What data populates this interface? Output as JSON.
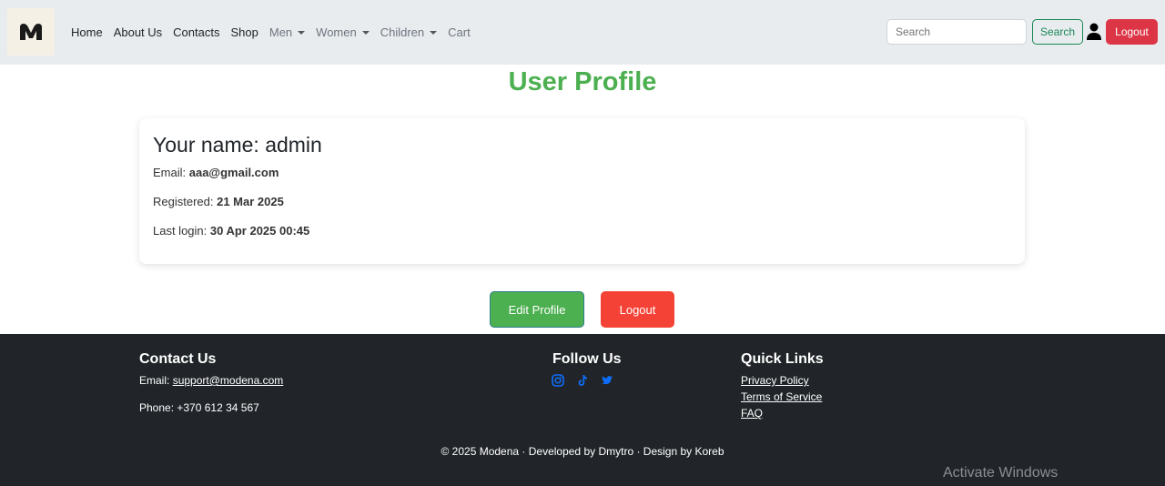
{
  "nav": {
    "logo": "Modena logo",
    "links": [
      {
        "label": "Home"
      },
      {
        "label": "About Us"
      },
      {
        "label": "Contacts"
      },
      {
        "label": "Shop"
      },
      {
        "label": "Men"
      },
      {
        "label": "Women"
      },
      {
        "label": "Children"
      },
      {
        "label": "Cart"
      }
    ],
    "search_placeholder": "Search",
    "search_button": "Search",
    "logout_button": "Logout"
  },
  "main": {
    "title": "User Profile",
    "name_label": "Your name: ",
    "name_value": "admin",
    "email_label": "Email: ",
    "email_value": "aaa@gmail.com",
    "registered_label": "Registered: ",
    "registered_value": "21 Mar 2025",
    "last_login_label": "Last login: ",
    "last_login_value": "30 Apr 2025 00:45",
    "edit_button": "Edit Profile",
    "logout_button": "Logout"
  },
  "footer": {
    "contact_heading": "Contact Us",
    "email_label": "Email: ",
    "email_value": "support@modena.com",
    "phone": "Phone: +370 612 34 567",
    "follow_heading": "Follow Us",
    "social_icons": [
      "instagram-icon",
      "tiktok-icon",
      "twitter-icon"
    ],
    "links_heading": "Quick Links",
    "links": [
      "Privacy Policy",
      "Terms of Service",
      "FAQ"
    ],
    "copyright": "© 2025 Modena · Developed by Dmytro · Design by Koreb"
  },
  "overlay": {
    "activate_windows": "Activate Windows"
  },
  "colors": {
    "accent_green": "#4caf50",
    "danger_red": "#dc3545",
    "footer_bg": "#212529",
    "social_blue": "#0d6efd"
  }
}
